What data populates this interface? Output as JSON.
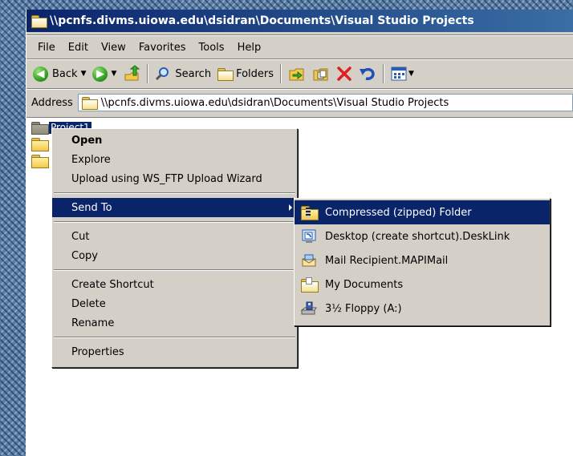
{
  "window": {
    "title": "\\\\pcnfs.divms.uiowa.edu\\dsidran\\Documents\\Visual Studio Projects"
  },
  "menubar": [
    "File",
    "Edit",
    "View",
    "Favorites",
    "Tools",
    "Help"
  ],
  "toolbar": {
    "back": "Back",
    "search": "Search",
    "folders": "Folders"
  },
  "address": {
    "label": "Address",
    "value": "\\\\pcnfs.divms.uiowa.edu\\dsidran\\Documents\\Visual Studio Projects"
  },
  "files": [
    {
      "name": "Project1"
    }
  ],
  "context_menu": {
    "items": [
      "Open",
      "Explore",
      "Upload using WS_FTP Upload Wizard",
      "Send To",
      "Cut",
      "Copy",
      "Create Shortcut",
      "Delete",
      "Rename",
      "Properties"
    ]
  },
  "send_to_menu": {
    "items": [
      "Compressed (zipped) Folder",
      "Desktop (create shortcut).DeskLink",
      "Mail Recipient.MAPIMail",
      "My Documents",
      "3½ Floppy (A:)"
    ]
  }
}
